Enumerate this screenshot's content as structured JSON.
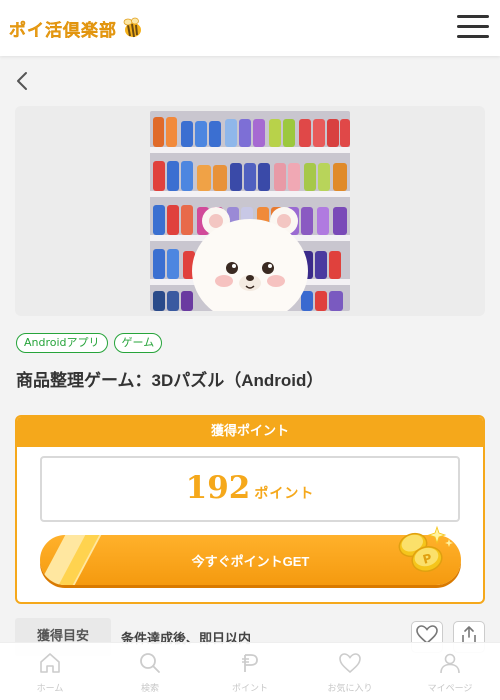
{
  "header": {
    "logo_text": "ポイ活倶楽部",
    "logo_icon": "bee-icon",
    "menu_icon": "hamburger-menu-icon"
  },
  "nav": {
    "back_icon": "chevron-left-icon"
  },
  "offer": {
    "image_icon": "convenience-store-shelf-bear-image",
    "tags": [
      "Androidアプリ",
      "ゲーム"
    ],
    "title": "商品整理ゲーム：3Dパズル（Android）"
  },
  "points": {
    "heading": "獲得ポイント",
    "value": "192",
    "unit": "ポイント",
    "button_label": "今すぐポイントGET",
    "coin_icon": "coins-icon"
  },
  "estimate": {
    "label": "獲得目安",
    "value": "条件達成後、即日以内"
  },
  "actions": {
    "favorite_icon": "heart-icon",
    "share_icon": "share-icon"
  },
  "tabbar": {
    "items": [
      {
        "label": "ホーム",
        "icon": "home-icon"
      },
      {
        "label": "検索",
        "icon": "search-icon"
      },
      {
        "label": "ポイント",
        "icon": "point-icon"
      },
      {
        "label": "お気に入り",
        "icon": "heart-icon"
      },
      {
        "label": "マイページ",
        "icon": "user-icon"
      }
    ]
  },
  "colors": {
    "accent": "#f5a81b",
    "tag_green": "#27a43b",
    "text_dark": "#333333"
  }
}
